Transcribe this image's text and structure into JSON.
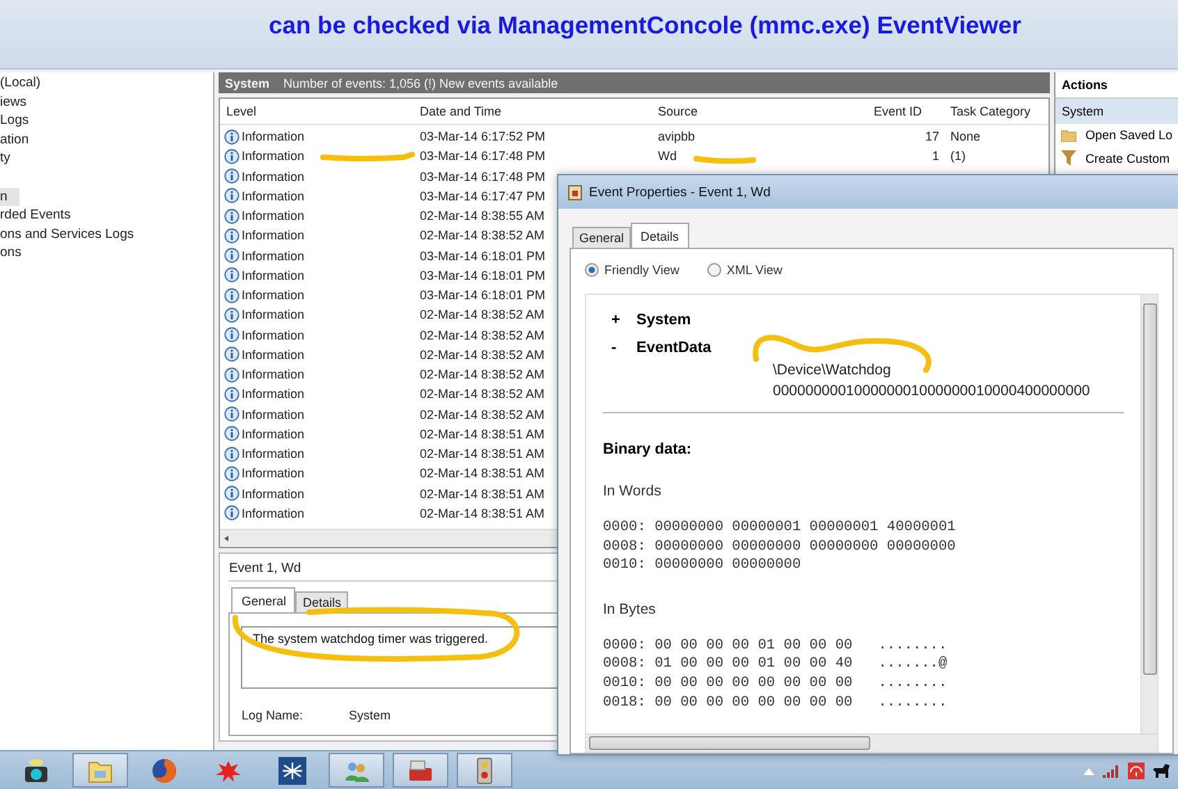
{
  "annotation": "can be checked via ManagementConcole (mmc.exe) EventViewer",
  "nav": {
    "items": [
      {
        "label": "(Local)",
        "selected": false
      },
      {
        "label": "iews",
        "selected": false
      },
      {
        "label": "Logs",
        "selected": false
      },
      {
        "label": "ation",
        "selected": false
      },
      {
        "label": "ty",
        "selected": false
      },
      {
        "label": "n",
        "selected": true
      },
      {
        "label": "rded Events",
        "selected": false
      },
      {
        "label": "ons and Services Logs",
        "selected": false
      },
      {
        "label": "ons",
        "selected": false
      }
    ]
  },
  "log": {
    "name": "System",
    "summary": "Number of events: 1,056 (!) New events available",
    "columns": [
      "Level",
      "Date and Time",
      "Source",
      "Event ID",
      "Task Category"
    ],
    "rows": [
      {
        "level": "Information",
        "date": "03-Mar-14 6:17:52 PM",
        "source": "avipbb",
        "event_id": "17",
        "category": "None"
      },
      {
        "level": "Information",
        "date": "03-Mar-14 6:17:48 PM",
        "source": "Wd",
        "event_id": "1",
        "category": "(1)"
      },
      {
        "level": "Information",
        "date": "03-Mar-14 6:17:48 PM"
      },
      {
        "level": "Information",
        "date": "03-Mar-14 6:17:47 PM"
      },
      {
        "level": "Information",
        "date": "02-Mar-14 8:38:55 AM"
      },
      {
        "level": "Information",
        "date": "02-Mar-14 8:38:52 AM"
      },
      {
        "level": "Information",
        "date": "03-Mar-14 6:18:01 PM"
      },
      {
        "level": "Information",
        "date": "03-Mar-14 6:18:01 PM"
      },
      {
        "level": "Information",
        "date": "03-Mar-14 6:18:01 PM"
      },
      {
        "level": "Information",
        "date": "02-Mar-14 8:38:52 AM"
      },
      {
        "level": "Information",
        "date": "02-Mar-14 8:38:52 AM"
      },
      {
        "level": "Information",
        "date": "02-Mar-14 8:38:52 AM"
      },
      {
        "level": "Information",
        "date": "02-Mar-14 8:38:52 AM"
      },
      {
        "level": "Information",
        "date": "02-Mar-14 8:38:52 AM"
      },
      {
        "level": "Information",
        "date": "02-Mar-14 8:38:52 AM"
      },
      {
        "level": "Information",
        "date": "02-Mar-14 8:38:51 AM"
      },
      {
        "level": "Information",
        "date": "02-Mar-14 8:38:51 AM"
      },
      {
        "level": "Information",
        "date": "02-Mar-14 8:38:51 AM"
      },
      {
        "level": "Information",
        "date": "02-Mar-14 8:38:51 AM"
      },
      {
        "level": "Information",
        "date": "02-Mar-14 8:38:51 AM"
      }
    ]
  },
  "preview": {
    "title": "Event 1, Wd",
    "tabs": [
      {
        "label": "General",
        "selected": true
      },
      {
        "label": "Details",
        "selected": false
      }
    ],
    "message": "The system watchdog timer was triggered.",
    "fields": [
      {
        "label": "Log Name:",
        "value": "System"
      }
    ]
  },
  "actions": {
    "title": "Actions",
    "section": "System",
    "items": [
      {
        "label": "Open Saved Lo",
        "kind": "folder"
      },
      {
        "label": "Create Custom",
        "kind": "filter"
      }
    ]
  },
  "dialog": {
    "title": "Event Properties - Event 1, Wd",
    "tabs": [
      {
        "label": "General",
        "selected": false
      },
      {
        "label": "Details",
        "selected": true
      }
    ],
    "views": [
      {
        "label": "Friendly View",
        "selected": true
      },
      {
        "label": "XML View",
        "selected": false
      }
    ],
    "tree": [
      {
        "sign": "+",
        "label": "System"
      },
      {
        "sign": "-",
        "label": "EventData",
        "values": [
          "\\Device\\Watchdog",
          "000000000100000001000000010000400000000"
        ]
      }
    ],
    "binary_title": "Binary data:",
    "words_title": "In Words",
    "words": [
      "0000: 00000000 00000001 00000001 40000001",
      "0008: 00000000 00000000 00000000 00000000",
      "0010: 00000000 00000000"
    ],
    "bytes_title": "In Bytes",
    "bytes": [
      "0000: 00 00 00 00 01 00 00 00   ........",
      "0008: 01 00 00 00 01 00 00 40   .......@",
      "0010: 00 00 00 00 00 00 00 00   ........",
      "0018: 00 00 00 00 00 00 00 00   ........"
    ]
  },
  "taskbar": {
    "apps": [
      {
        "kind": "camera",
        "active": false
      },
      {
        "kind": "folder",
        "active": true
      },
      {
        "kind": "globe",
        "active": false
      },
      {
        "kind": "splat",
        "active": false
      },
      {
        "kind": "spider",
        "active": false
      },
      {
        "kind": "people",
        "active": true
      },
      {
        "kind": "toolbox",
        "active": true
      },
      {
        "kind": "phone",
        "active": true
      }
    ]
  }
}
